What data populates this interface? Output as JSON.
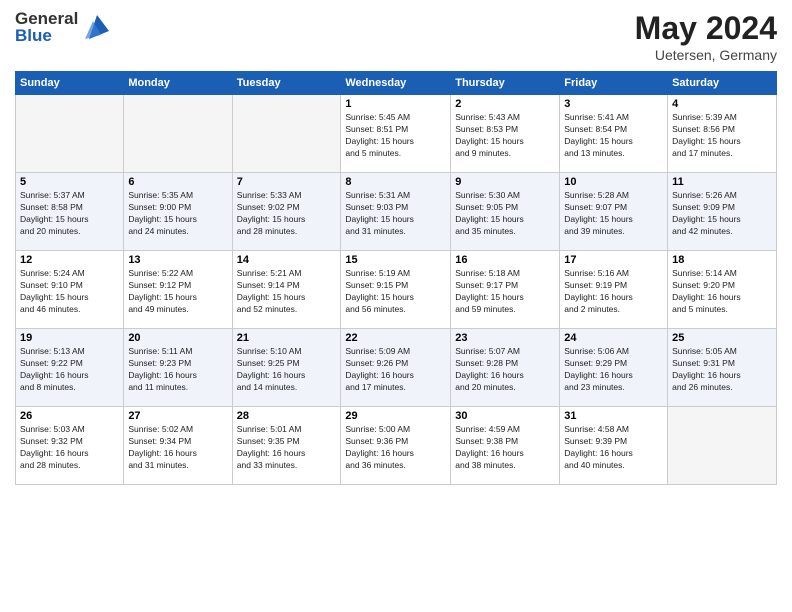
{
  "header": {
    "logo_general": "General",
    "logo_blue": "Blue",
    "title": "May 2024",
    "subtitle": "Uetersen, Germany"
  },
  "days_of_week": [
    "Sunday",
    "Monday",
    "Tuesday",
    "Wednesday",
    "Thursday",
    "Friday",
    "Saturday"
  ],
  "weeks": [
    {
      "days": [
        {
          "num": "",
          "info": ""
        },
        {
          "num": "",
          "info": ""
        },
        {
          "num": "",
          "info": ""
        },
        {
          "num": "1",
          "info": "Sunrise: 5:45 AM\nSunset: 8:51 PM\nDaylight: 15 hours\nand 5 minutes."
        },
        {
          "num": "2",
          "info": "Sunrise: 5:43 AM\nSunset: 8:53 PM\nDaylight: 15 hours\nand 9 minutes."
        },
        {
          "num": "3",
          "info": "Sunrise: 5:41 AM\nSunset: 8:54 PM\nDaylight: 15 hours\nand 13 minutes."
        },
        {
          "num": "4",
          "info": "Sunrise: 5:39 AM\nSunset: 8:56 PM\nDaylight: 15 hours\nand 17 minutes."
        }
      ]
    },
    {
      "days": [
        {
          "num": "5",
          "info": "Sunrise: 5:37 AM\nSunset: 8:58 PM\nDaylight: 15 hours\nand 20 minutes."
        },
        {
          "num": "6",
          "info": "Sunrise: 5:35 AM\nSunset: 9:00 PM\nDaylight: 15 hours\nand 24 minutes."
        },
        {
          "num": "7",
          "info": "Sunrise: 5:33 AM\nSunset: 9:02 PM\nDaylight: 15 hours\nand 28 minutes."
        },
        {
          "num": "8",
          "info": "Sunrise: 5:31 AM\nSunset: 9:03 PM\nDaylight: 15 hours\nand 31 minutes."
        },
        {
          "num": "9",
          "info": "Sunrise: 5:30 AM\nSunset: 9:05 PM\nDaylight: 15 hours\nand 35 minutes."
        },
        {
          "num": "10",
          "info": "Sunrise: 5:28 AM\nSunset: 9:07 PM\nDaylight: 15 hours\nand 39 minutes."
        },
        {
          "num": "11",
          "info": "Sunrise: 5:26 AM\nSunset: 9:09 PM\nDaylight: 15 hours\nand 42 minutes."
        }
      ]
    },
    {
      "days": [
        {
          "num": "12",
          "info": "Sunrise: 5:24 AM\nSunset: 9:10 PM\nDaylight: 15 hours\nand 46 minutes."
        },
        {
          "num": "13",
          "info": "Sunrise: 5:22 AM\nSunset: 9:12 PM\nDaylight: 15 hours\nand 49 minutes."
        },
        {
          "num": "14",
          "info": "Sunrise: 5:21 AM\nSunset: 9:14 PM\nDaylight: 15 hours\nand 52 minutes."
        },
        {
          "num": "15",
          "info": "Sunrise: 5:19 AM\nSunset: 9:15 PM\nDaylight: 15 hours\nand 56 minutes."
        },
        {
          "num": "16",
          "info": "Sunrise: 5:18 AM\nSunset: 9:17 PM\nDaylight: 15 hours\nand 59 minutes."
        },
        {
          "num": "17",
          "info": "Sunrise: 5:16 AM\nSunset: 9:19 PM\nDaylight: 16 hours\nand 2 minutes."
        },
        {
          "num": "18",
          "info": "Sunrise: 5:14 AM\nSunset: 9:20 PM\nDaylight: 16 hours\nand 5 minutes."
        }
      ]
    },
    {
      "days": [
        {
          "num": "19",
          "info": "Sunrise: 5:13 AM\nSunset: 9:22 PM\nDaylight: 16 hours\nand 8 minutes."
        },
        {
          "num": "20",
          "info": "Sunrise: 5:11 AM\nSunset: 9:23 PM\nDaylight: 16 hours\nand 11 minutes."
        },
        {
          "num": "21",
          "info": "Sunrise: 5:10 AM\nSunset: 9:25 PM\nDaylight: 16 hours\nand 14 minutes."
        },
        {
          "num": "22",
          "info": "Sunrise: 5:09 AM\nSunset: 9:26 PM\nDaylight: 16 hours\nand 17 minutes."
        },
        {
          "num": "23",
          "info": "Sunrise: 5:07 AM\nSunset: 9:28 PM\nDaylight: 16 hours\nand 20 minutes."
        },
        {
          "num": "24",
          "info": "Sunrise: 5:06 AM\nSunset: 9:29 PM\nDaylight: 16 hours\nand 23 minutes."
        },
        {
          "num": "25",
          "info": "Sunrise: 5:05 AM\nSunset: 9:31 PM\nDaylight: 16 hours\nand 26 minutes."
        }
      ]
    },
    {
      "days": [
        {
          "num": "26",
          "info": "Sunrise: 5:03 AM\nSunset: 9:32 PM\nDaylight: 16 hours\nand 28 minutes."
        },
        {
          "num": "27",
          "info": "Sunrise: 5:02 AM\nSunset: 9:34 PM\nDaylight: 16 hours\nand 31 minutes."
        },
        {
          "num": "28",
          "info": "Sunrise: 5:01 AM\nSunset: 9:35 PM\nDaylight: 16 hours\nand 33 minutes."
        },
        {
          "num": "29",
          "info": "Sunrise: 5:00 AM\nSunset: 9:36 PM\nDaylight: 16 hours\nand 36 minutes."
        },
        {
          "num": "30",
          "info": "Sunrise: 4:59 AM\nSunset: 9:38 PM\nDaylight: 16 hours\nand 38 minutes."
        },
        {
          "num": "31",
          "info": "Sunrise: 4:58 AM\nSunset: 9:39 PM\nDaylight: 16 hours\nand 40 minutes."
        },
        {
          "num": "",
          "info": ""
        }
      ]
    }
  ]
}
